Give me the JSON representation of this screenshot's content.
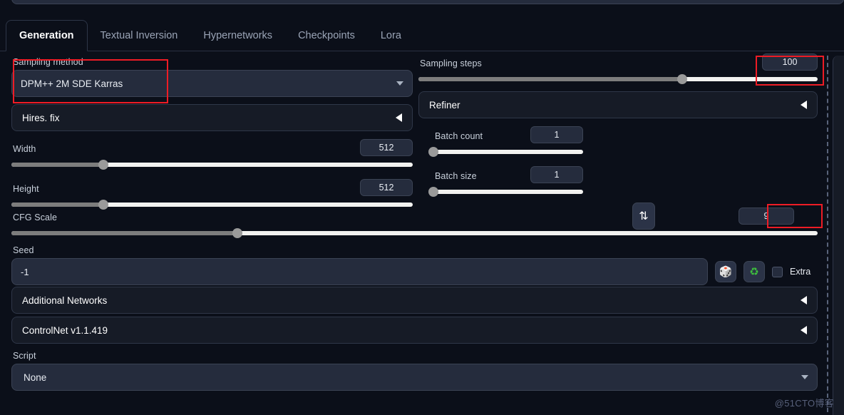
{
  "tabs": [
    {
      "label": "Generation",
      "active": true
    },
    {
      "label": "Textual Inversion",
      "active": false
    },
    {
      "label": "Hypernetworks",
      "active": false
    },
    {
      "label": "Checkpoints",
      "active": false
    },
    {
      "label": "Lora",
      "active": false
    }
  ],
  "sampling_method": {
    "label": "Sampling method",
    "value": "DPM++ 2M SDE Karras"
  },
  "sampling_steps": {
    "label": "Sampling steps",
    "value": "100",
    "fill_percent": 66
  },
  "hires_fix": {
    "label": "Hires. fix"
  },
  "refiner": {
    "label": "Refiner"
  },
  "width": {
    "label": "Width",
    "value": "512",
    "fill_percent": 23
  },
  "height": {
    "label": "Height",
    "value": "512",
    "fill_percent": 23
  },
  "swap": {
    "icon": "swap-vertical-icon",
    "glyph": "⇅"
  },
  "batch_count": {
    "label": "Batch count",
    "value": "1",
    "fill_percent": 0
  },
  "batch_size": {
    "label": "Batch size",
    "value": "1",
    "fill_percent": 0
  },
  "cfg_scale": {
    "label": "CFG Scale",
    "value": "9",
    "fill_percent": 28
  },
  "seed": {
    "label": "Seed",
    "value": "-1",
    "dice_glyph": "🎲",
    "recycle_glyph": "♻",
    "extra_label": "Extra",
    "extra_checked": false
  },
  "additional_networks": {
    "label": "Additional Networks"
  },
  "controlnet": {
    "label": "ControlNet v1.1.419"
  },
  "script": {
    "label": "Script",
    "value": "None"
  },
  "watermark": {
    "text": "@51CTO博客"
  },
  "colors": {
    "background": "#0b0f19",
    "panel": "#161b26",
    "input": "#252c3d",
    "border": "#3b4354",
    "text": "#e8ecf2",
    "muted": "#9aa4b6",
    "highlight": "#ee1c25",
    "slider_track": "#f2f2f0",
    "slider_fill": "#7d7d7d"
  }
}
